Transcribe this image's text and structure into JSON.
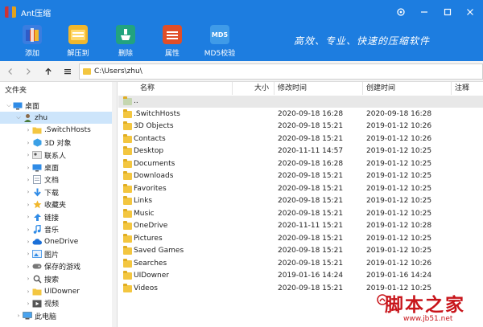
{
  "window": {
    "title": "Ant压缩"
  },
  "toolbar": {
    "buttons": [
      {
        "label": "添加",
        "icon": "archive-add-icon",
        "color": "#3a7de0"
      },
      {
        "label": "解压到",
        "icon": "folder-extract-icon",
        "color": "#f1b72c"
      },
      {
        "label": "删除",
        "icon": "broom-delete-icon",
        "color": "#22a37f"
      },
      {
        "label": "属性",
        "icon": "toolbox-icon",
        "color": "#e04e28"
      },
      {
        "label": "MD5校验",
        "icon": "md5-icon",
        "color": "#3f9be8"
      }
    ],
    "slogan": "高效、专业、快速的压缩软件"
  },
  "address": {
    "path": "C:\\Users\\zhu\\"
  },
  "tree": {
    "title": "文件夹",
    "items": [
      {
        "label": "桌面",
        "icon": "desktop-icon",
        "indent": 0,
        "expanded": true,
        "selected": false
      },
      {
        "label": "zhu",
        "icon": "user-icon",
        "indent": 1,
        "expanded": true,
        "selected": true
      },
      {
        "label": ".SwitchHosts",
        "icon": "folder-icon",
        "indent": 2,
        "expanded": false,
        "selected": false
      },
      {
        "label": "3D 对象",
        "icon": "cube-3d-icon",
        "indent": 2,
        "expanded": false,
        "selected": false
      },
      {
        "label": "联系人",
        "icon": "contacts-icon",
        "indent": 2,
        "expanded": false,
        "selected": false
      },
      {
        "label": "桌面",
        "icon": "desktop-icon",
        "indent": 2,
        "expanded": false,
        "selected": false
      },
      {
        "label": "文档",
        "icon": "document-icon",
        "indent": 2,
        "expanded": false,
        "selected": false
      },
      {
        "label": "下载",
        "icon": "download-icon",
        "indent": 2,
        "expanded": false,
        "selected": false
      },
      {
        "label": "收藏夹",
        "icon": "star-icon",
        "indent": 2,
        "expanded": false,
        "selected": false
      },
      {
        "label": "链接",
        "icon": "link-icon",
        "indent": 2,
        "expanded": false,
        "selected": false
      },
      {
        "label": "音乐",
        "icon": "music-icon",
        "indent": 2,
        "expanded": false,
        "selected": false
      },
      {
        "label": "OneDrive",
        "icon": "cloud-icon",
        "indent": 2,
        "expanded": false,
        "selected": false
      },
      {
        "label": "图片",
        "icon": "picture-icon",
        "indent": 2,
        "expanded": false,
        "selected": false
      },
      {
        "label": "保存的游戏",
        "icon": "gamepad-icon",
        "indent": 2,
        "expanded": false,
        "selected": false
      },
      {
        "label": "搜索",
        "icon": "search-icon",
        "indent": 2,
        "expanded": false,
        "selected": false
      },
      {
        "label": "UIDowner",
        "icon": "folder-icon",
        "indent": 2,
        "expanded": false,
        "selected": false
      },
      {
        "label": "视频",
        "icon": "video-icon",
        "indent": 2,
        "expanded": false,
        "selected": false
      },
      {
        "label": "此电脑",
        "icon": "computer-icon",
        "indent": 1,
        "expanded": false,
        "selected": false
      }
    ]
  },
  "list": {
    "columns": [
      "名称",
      "大小",
      "修改时间",
      "创建时间",
      "注释"
    ],
    "rows": [
      {
        "name": "..",
        "size": "",
        "modified": "",
        "created": "",
        "comment": "",
        "parent": true
      },
      {
        "name": ".SwitchHosts",
        "size": "",
        "modified": "2020-09-18 16:28",
        "created": "2020-09-18 16:28",
        "comment": ""
      },
      {
        "name": "3D Objects",
        "size": "",
        "modified": "2020-09-18 15:21",
        "created": "2019-01-12 10:26",
        "comment": ""
      },
      {
        "name": "Contacts",
        "size": "",
        "modified": "2020-09-18 15:21",
        "created": "2019-01-12 10:26",
        "comment": ""
      },
      {
        "name": "Desktop",
        "size": "",
        "modified": "2020-11-11 14:57",
        "created": "2019-01-12 10:25",
        "comment": ""
      },
      {
        "name": "Documents",
        "size": "",
        "modified": "2020-09-18 16:28",
        "created": "2019-01-12 10:25",
        "comment": ""
      },
      {
        "name": "Downloads",
        "size": "",
        "modified": "2020-09-18 15:21",
        "created": "2019-01-12 10:25",
        "comment": ""
      },
      {
        "name": "Favorites",
        "size": "",
        "modified": "2020-09-18 15:21",
        "created": "2019-01-12 10:25",
        "comment": ""
      },
      {
        "name": "Links",
        "size": "",
        "modified": "2020-09-18 15:21",
        "created": "2019-01-12 10:25",
        "comment": ""
      },
      {
        "name": "Music",
        "size": "",
        "modified": "2020-09-18 15:21",
        "created": "2019-01-12 10:25",
        "comment": ""
      },
      {
        "name": "OneDrive",
        "size": "",
        "modified": "2020-11-11 15:21",
        "created": "2019-01-12 10:28",
        "comment": ""
      },
      {
        "name": "Pictures",
        "size": "",
        "modified": "2020-09-18 15:21",
        "created": "2019-01-12 10:25",
        "comment": ""
      },
      {
        "name": "Saved Games",
        "size": "",
        "modified": "2020-09-18 15:21",
        "created": "2019-01-12 10:25",
        "comment": ""
      },
      {
        "name": "Searches",
        "size": "",
        "modified": "2020-09-18 15:21",
        "created": "2019-01-12 10:26",
        "comment": ""
      },
      {
        "name": "UIDowner",
        "size": "",
        "modified": "2019-01-16 14:24",
        "created": "2019-01-16 14:24",
        "comment": ""
      },
      {
        "name": "Videos",
        "size": "",
        "modified": "2020-09-18 15:21",
        "created": "2019-01-12 10:25",
        "comment": ""
      }
    ]
  },
  "watermark": {
    "text": "脚本之家",
    "url": "www.jb51.net"
  },
  "colors": {
    "accent": "#1d7de0",
    "selection": "#cde5fb",
    "folder": "#f3c640",
    "watermark": "#c8151b"
  }
}
